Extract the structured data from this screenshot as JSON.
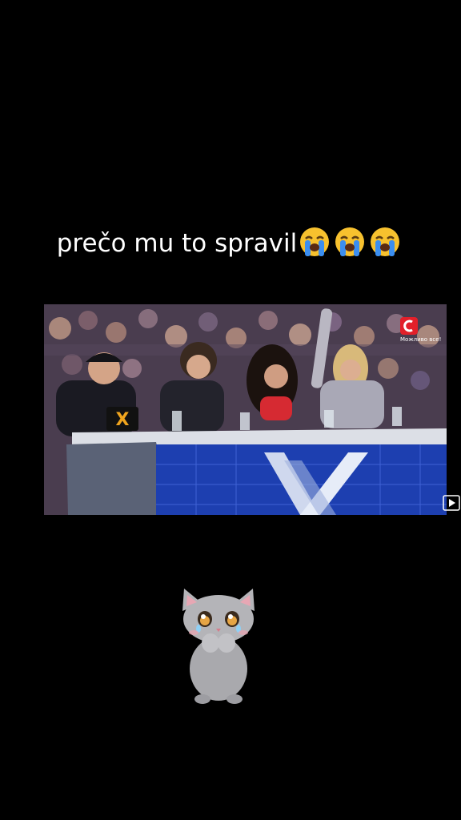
{
  "caption": {
    "text": "prečo mu to spravil",
    "emoji": [
      "loudly-crying-face",
      "loudly-crying-face",
      "loudly-crying-face"
    ]
  },
  "video": {
    "channel_logo": "stb-logo",
    "channel_slogan": "Можливо все!",
    "show_logo": "x-factor-logo"
  },
  "overlay": {
    "play_icon": "play-icon",
    "sticker": "crying-cat-sticker"
  },
  "colors": {
    "background": "#000000",
    "caption_text": "#ffffff",
    "channel_red": "#e2202a",
    "stage_blue": "#1d3fb0"
  }
}
